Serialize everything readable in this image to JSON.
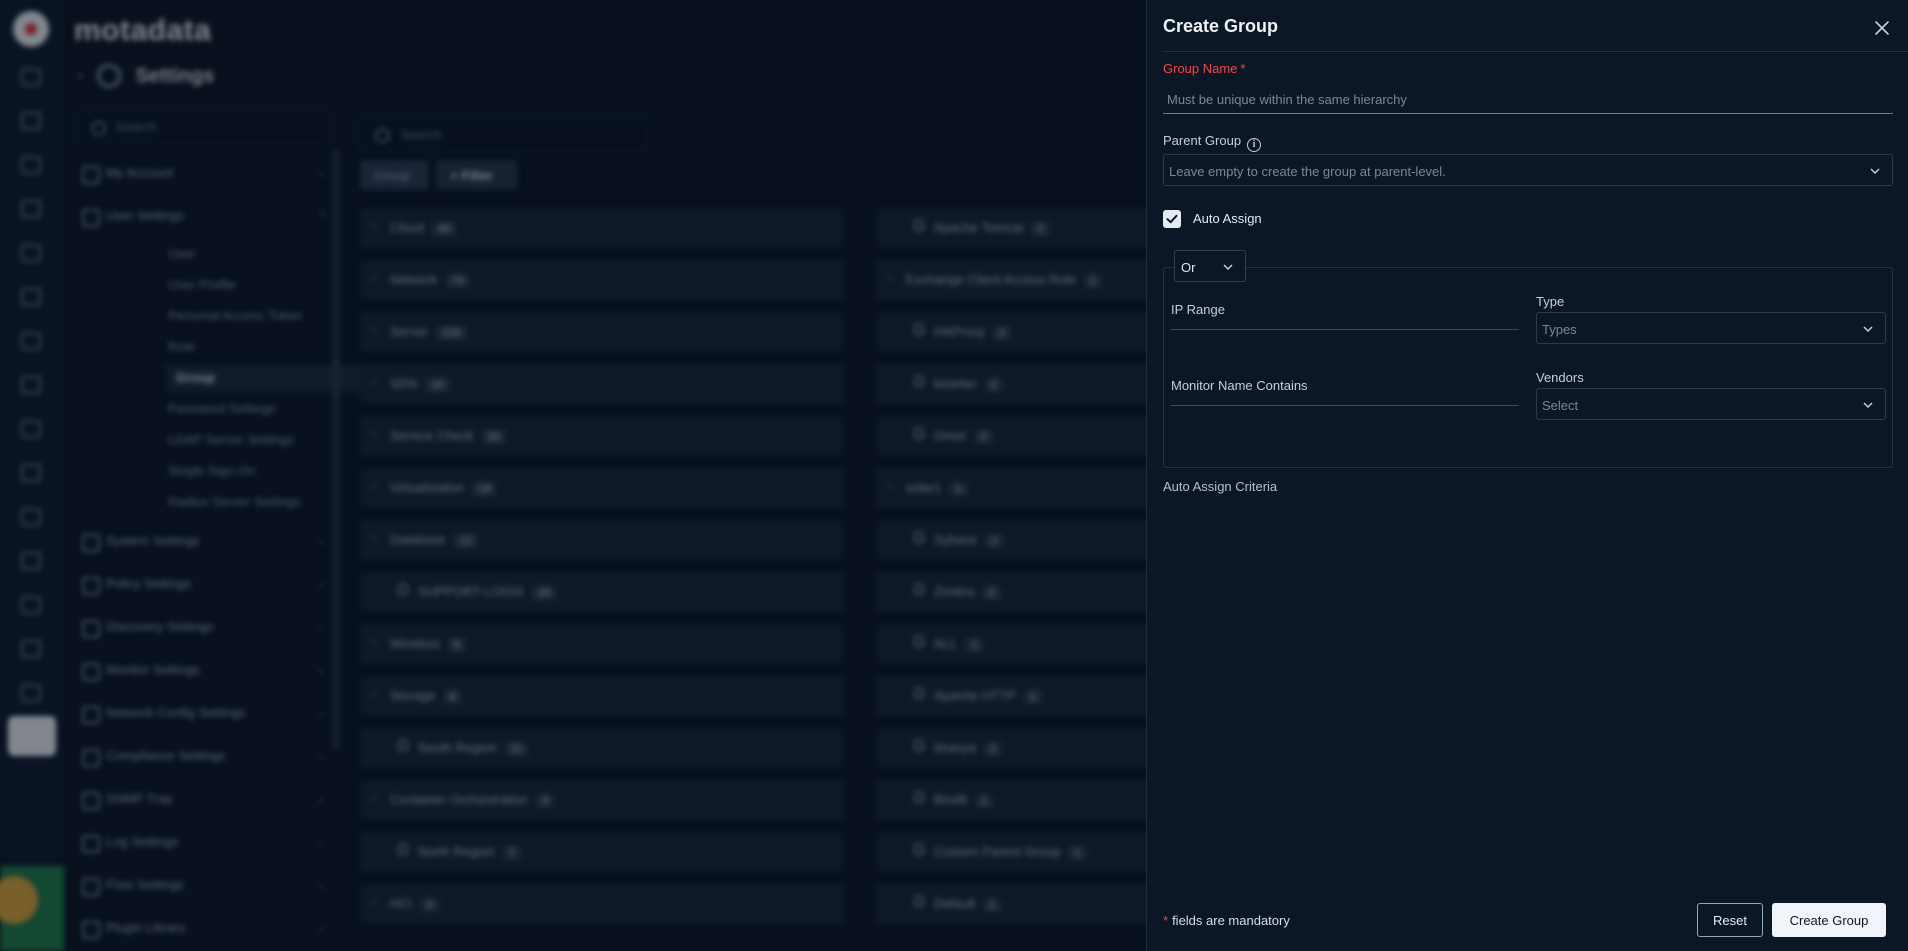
{
  "app": {
    "logo": "motadata",
    "settings_title": "Settings",
    "side_search_placeholder": "Search",
    "nav": [
      {
        "label": "My Account"
      },
      {
        "label": "User Settings"
      },
      {
        "label": "System Settings"
      },
      {
        "label": "Policy Settings"
      },
      {
        "label": "Discovery Settings"
      },
      {
        "label": "Monitor Settings"
      },
      {
        "label": "Network Config Settings"
      },
      {
        "label": "Compliance Settings"
      },
      {
        "label": "SNMP Trap"
      },
      {
        "label": "Log Settings"
      },
      {
        "label": "Flow Settings"
      },
      {
        "label": "Plugin Library"
      }
    ],
    "user_settings_sub": [
      {
        "label": "User"
      },
      {
        "label": "User Profile"
      },
      {
        "label": "Personal Access Token"
      },
      {
        "label": "Role"
      },
      {
        "label": "Group"
      },
      {
        "label": "Password Settings"
      },
      {
        "label": "LDAP Server Settings"
      },
      {
        "label": "Single Sign-On"
      },
      {
        "label": "Radius Server Settings"
      }
    ],
    "content_search_placeholder": "Search",
    "group_pill": "Group",
    "filter_pill": "+ Filter",
    "groups_left": [
      {
        "name": "Cloud",
        "count": "40",
        "expandable": true
      },
      {
        "name": "Network",
        "count": "74",
        "expandable": true
      },
      {
        "name": "Server",
        "count": "218",
        "expandable": true
      },
      {
        "name": "SDN",
        "count": "15",
        "expandable": true
      },
      {
        "name": "Service Check",
        "count": "33",
        "expandable": true
      },
      {
        "name": "Virtualization",
        "count": "18",
        "expandable": true
      },
      {
        "name": "Database",
        "count": "12",
        "expandable": true
      },
      {
        "name": "SUPPORT-LOGIX",
        "count": "26",
        "expandable": false
      },
      {
        "name": "Wireless",
        "count": "8",
        "expandable": true
      },
      {
        "name": "Storage",
        "count": "6",
        "expandable": true
      },
      {
        "name": "South Region",
        "count": "11",
        "expandable": false
      },
      {
        "name": "Container Orchestration",
        "count": "4",
        "expandable": true
      },
      {
        "name": "North Region",
        "count": "7",
        "expandable": false
      },
      {
        "name": "HCI",
        "count": "3",
        "expandable": true
      }
    ],
    "groups_right": [
      {
        "name": "Apache Tomcat",
        "count": "2",
        "expandable": false
      },
      {
        "name": "Exchange Client Access Role",
        "count": "1",
        "expandable": true
      },
      {
        "name": "HAProxy",
        "count": "2",
        "expandable": false
      },
      {
        "name": "kearlan",
        "count": "2",
        "expandable": false
      },
      {
        "name": "Omer",
        "count": "2",
        "expandable": false
      },
      {
        "name": "solar1",
        "count": "1",
        "expandable": true
      },
      {
        "name": "Sybase",
        "count": "2",
        "expandable": false
      },
      {
        "name": "Zimbra",
        "count": "2",
        "expandable": false
      },
      {
        "name": "ALL",
        "count": "1",
        "expandable": false
      },
      {
        "name": "Apache HTTP",
        "count": "1",
        "expandable": false
      },
      {
        "name": "bhavya",
        "count": "1",
        "expandable": false
      },
      {
        "name": "Bind9",
        "count": "1",
        "expandable": false
      },
      {
        "name": "Custom Parent Group",
        "count": "1",
        "expandable": false
      },
      {
        "name": "Default",
        "count": "1",
        "expandable": false
      }
    ]
  },
  "drawer": {
    "title": "Create Group",
    "group_name_label": "Group Name",
    "required_marker": "*",
    "group_name_placeholder": "Must be unique within the same hierarchy",
    "parent_group_label": "Parent Group",
    "parent_group_placeholder": "Leave empty to create the group at parent-level.",
    "auto_assign_label": "Auto Assign",
    "auto_assign_checked": true,
    "operator": "Or",
    "ip_range_label": "IP Range",
    "type_label": "Type",
    "type_placeholder": "Types",
    "monitor_name_label": "Monitor Name Contains",
    "vendors_label": "Vendors",
    "vendors_placeholder": "Select",
    "criteria_caption": "Auto Assign Criteria",
    "mandatory_note": "fields are mandatory",
    "reset_label": "Reset",
    "create_label": "Create Group"
  },
  "colors": {
    "background": "#0b1624",
    "drawer": "#0c1726",
    "required": "#ef4b4b",
    "primary_button": "#f1f4f8"
  },
  "icons": [
    "close-icon",
    "info-icon",
    "chevron-down-icon",
    "check-icon",
    "search-icon",
    "gear-icon"
  ]
}
